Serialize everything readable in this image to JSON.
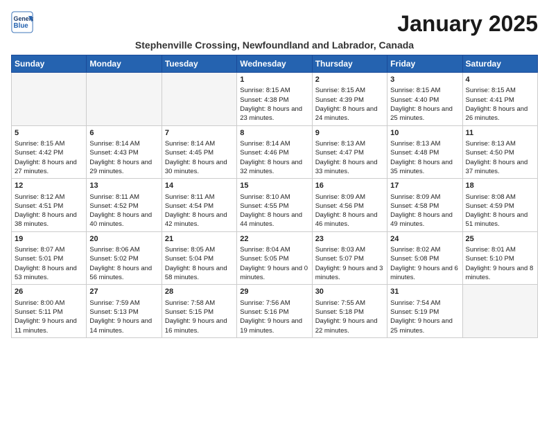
{
  "header": {
    "logo_line1": "General",
    "logo_line2": "Blue",
    "month": "January 2025",
    "subtitle": "Stephenville Crossing, Newfoundland and Labrador, Canada"
  },
  "weekdays": [
    "Sunday",
    "Monday",
    "Tuesday",
    "Wednesday",
    "Thursday",
    "Friday",
    "Saturday"
  ],
  "weeks": [
    [
      {
        "day": "",
        "empty": true
      },
      {
        "day": "",
        "empty": true
      },
      {
        "day": "",
        "empty": true
      },
      {
        "day": "1",
        "sunrise": "8:15 AM",
        "sunset": "4:38 PM",
        "daylight": "8 hours and 23 minutes."
      },
      {
        "day": "2",
        "sunrise": "8:15 AM",
        "sunset": "4:39 PM",
        "daylight": "8 hours and 24 minutes."
      },
      {
        "day": "3",
        "sunrise": "8:15 AM",
        "sunset": "4:40 PM",
        "daylight": "8 hours and 25 minutes."
      },
      {
        "day": "4",
        "sunrise": "8:15 AM",
        "sunset": "4:41 PM",
        "daylight": "8 hours and 26 minutes."
      }
    ],
    [
      {
        "day": "5",
        "sunrise": "8:15 AM",
        "sunset": "4:42 PM",
        "daylight": "8 hours and 27 minutes."
      },
      {
        "day": "6",
        "sunrise": "8:14 AM",
        "sunset": "4:43 PM",
        "daylight": "8 hours and 29 minutes."
      },
      {
        "day": "7",
        "sunrise": "8:14 AM",
        "sunset": "4:45 PM",
        "daylight": "8 hours and 30 minutes."
      },
      {
        "day": "8",
        "sunrise": "8:14 AM",
        "sunset": "4:46 PM",
        "daylight": "8 hours and 32 minutes."
      },
      {
        "day": "9",
        "sunrise": "8:13 AM",
        "sunset": "4:47 PM",
        "daylight": "8 hours and 33 minutes."
      },
      {
        "day": "10",
        "sunrise": "8:13 AM",
        "sunset": "4:48 PM",
        "daylight": "8 hours and 35 minutes."
      },
      {
        "day": "11",
        "sunrise": "8:13 AM",
        "sunset": "4:50 PM",
        "daylight": "8 hours and 37 minutes."
      }
    ],
    [
      {
        "day": "12",
        "sunrise": "8:12 AM",
        "sunset": "4:51 PM",
        "daylight": "8 hours and 38 minutes."
      },
      {
        "day": "13",
        "sunrise": "8:11 AM",
        "sunset": "4:52 PM",
        "daylight": "8 hours and 40 minutes."
      },
      {
        "day": "14",
        "sunrise": "8:11 AM",
        "sunset": "4:54 PM",
        "daylight": "8 hours and 42 minutes."
      },
      {
        "day": "15",
        "sunrise": "8:10 AM",
        "sunset": "4:55 PM",
        "daylight": "8 hours and 44 minutes."
      },
      {
        "day": "16",
        "sunrise": "8:09 AM",
        "sunset": "4:56 PM",
        "daylight": "8 hours and 46 minutes."
      },
      {
        "day": "17",
        "sunrise": "8:09 AM",
        "sunset": "4:58 PM",
        "daylight": "8 hours and 49 minutes."
      },
      {
        "day": "18",
        "sunrise": "8:08 AM",
        "sunset": "4:59 PM",
        "daylight": "8 hours and 51 minutes."
      }
    ],
    [
      {
        "day": "19",
        "sunrise": "8:07 AM",
        "sunset": "5:01 PM",
        "daylight": "8 hours and 53 minutes."
      },
      {
        "day": "20",
        "sunrise": "8:06 AM",
        "sunset": "5:02 PM",
        "daylight": "8 hours and 56 minutes."
      },
      {
        "day": "21",
        "sunrise": "8:05 AM",
        "sunset": "5:04 PM",
        "daylight": "8 hours and 58 minutes."
      },
      {
        "day": "22",
        "sunrise": "8:04 AM",
        "sunset": "5:05 PM",
        "daylight": "9 hours and 0 minutes."
      },
      {
        "day": "23",
        "sunrise": "8:03 AM",
        "sunset": "5:07 PM",
        "daylight": "9 hours and 3 minutes."
      },
      {
        "day": "24",
        "sunrise": "8:02 AM",
        "sunset": "5:08 PM",
        "daylight": "9 hours and 6 minutes."
      },
      {
        "day": "25",
        "sunrise": "8:01 AM",
        "sunset": "5:10 PM",
        "daylight": "9 hours and 8 minutes."
      }
    ],
    [
      {
        "day": "26",
        "sunrise": "8:00 AM",
        "sunset": "5:11 PM",
        "daylight": "9 hours and 11 minutes."
      },
      {
        "day": "27",
        "sunrise": "7:59 AM",
        "sunset": "5:13 PM",
        "daylight": "9 hours and 14 minutes."
      },
      {
        "day": "28",
        "sunrise": "7:58 AM",
        "sunset": "5:15 PM",
        "daylight": "9 hours and 16 minutes."
      },
      {
        "day": "29",
        "sunrise": "7:56 AM",
        "sunset": "5:16 PM",
        "daylight": "9 hours and 19 minutes."
      },
      {
        "day": "30",
        "sunrise": "7:55 AM",
        "sunset": "5:18 PM",
        "daylight": "9 hours and 22 minutes."
      },
      {
        "day": "31",
        "sunrise": "7:54 AM",
        "sunset": "5:19 PM",
        "daylight": "9 hours and 25 minutes."
      },
      {
        "day": "",
        "empty": true
      }
    ]
  ],
  "labels": {
    "sunrise_label": "Sunrise:",
    "sunset_label": "Sunset:",
    "daylight_label": "Daylight:"
  }
}
